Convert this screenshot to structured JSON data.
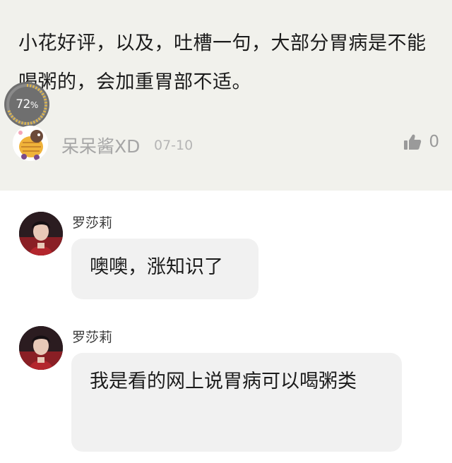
{
  "comment": {
    "text": "小花好评，以及，吐槽一句，大部分胃病是不能喝粥的，会加重胃部不适。",
    "progress_value": "72",
    "progress_unit": "%",
    "progress_fraction": 0.72,
    "author": "呆呆酱XD",
    "date": "07-10",
    "like_count": "0",
    "like_icon": "thumbs-up-icon"
  },
  "messages": [
    {
      "name": "罗莎莉",
      "text": "噢噢，涨知识了",
      "avatar": "user-avatar"
    },
    {
      "name": "罗莎莉",
      "text": "我是看的网上说胃病可以喝粥类",
      "avatar": "user-avatar"
    }
  ],
  "colors": {
    "card_bg": "#f1f1ec",
    "bubble_bg": "#f1f1f1",
    "progress_ring": "#e2b84a"
  }
}
